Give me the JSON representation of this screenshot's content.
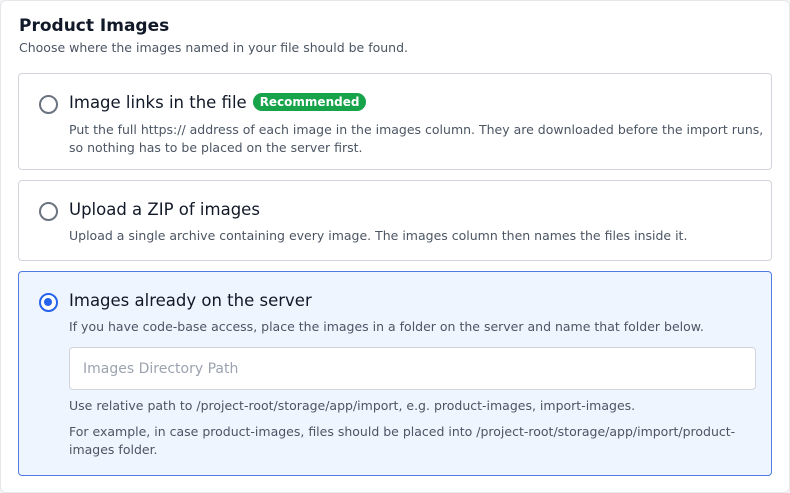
{
  "section": {
    "title": "Product Images",
    "subtitle": "Choose where the images named in your file should be found."
  },
  "options": [
    {
      "label": "Image links in the file",
      "badge": "Recommended",
      "description": "Put the full https:// address of each image in the images column. They are downloaded before the import runs, so nothing has to be placed on the server first.",
      "selected": false
    },
    {
      "label": "Upload a ZIP of images",
      "description": "Upload a single archive containing every image. The images column then names the files inside it.",
      "selected": false
    },
    {
      "label": "Images already on the server",
      "description": "If you have code-base access, place the images in a folder on the server and name that folder below.",
      "selected": true,
      "input": {
        "value": "",
        "placeholder": "Images Directory Path"
      },
      "help_1": "Use relative path to /project-root/storage/app/import, e.g. product-images, import-images.",
      "help_2": "For example, in case product-images, files should be placed into /project-root/storage/app/import/product-images folder."
    }
  ],
  "colors": {
    "accent": "#2563eb",
    "badge": "#16a34a",
    "selected_bg": "#eff5ff"
  }
}
